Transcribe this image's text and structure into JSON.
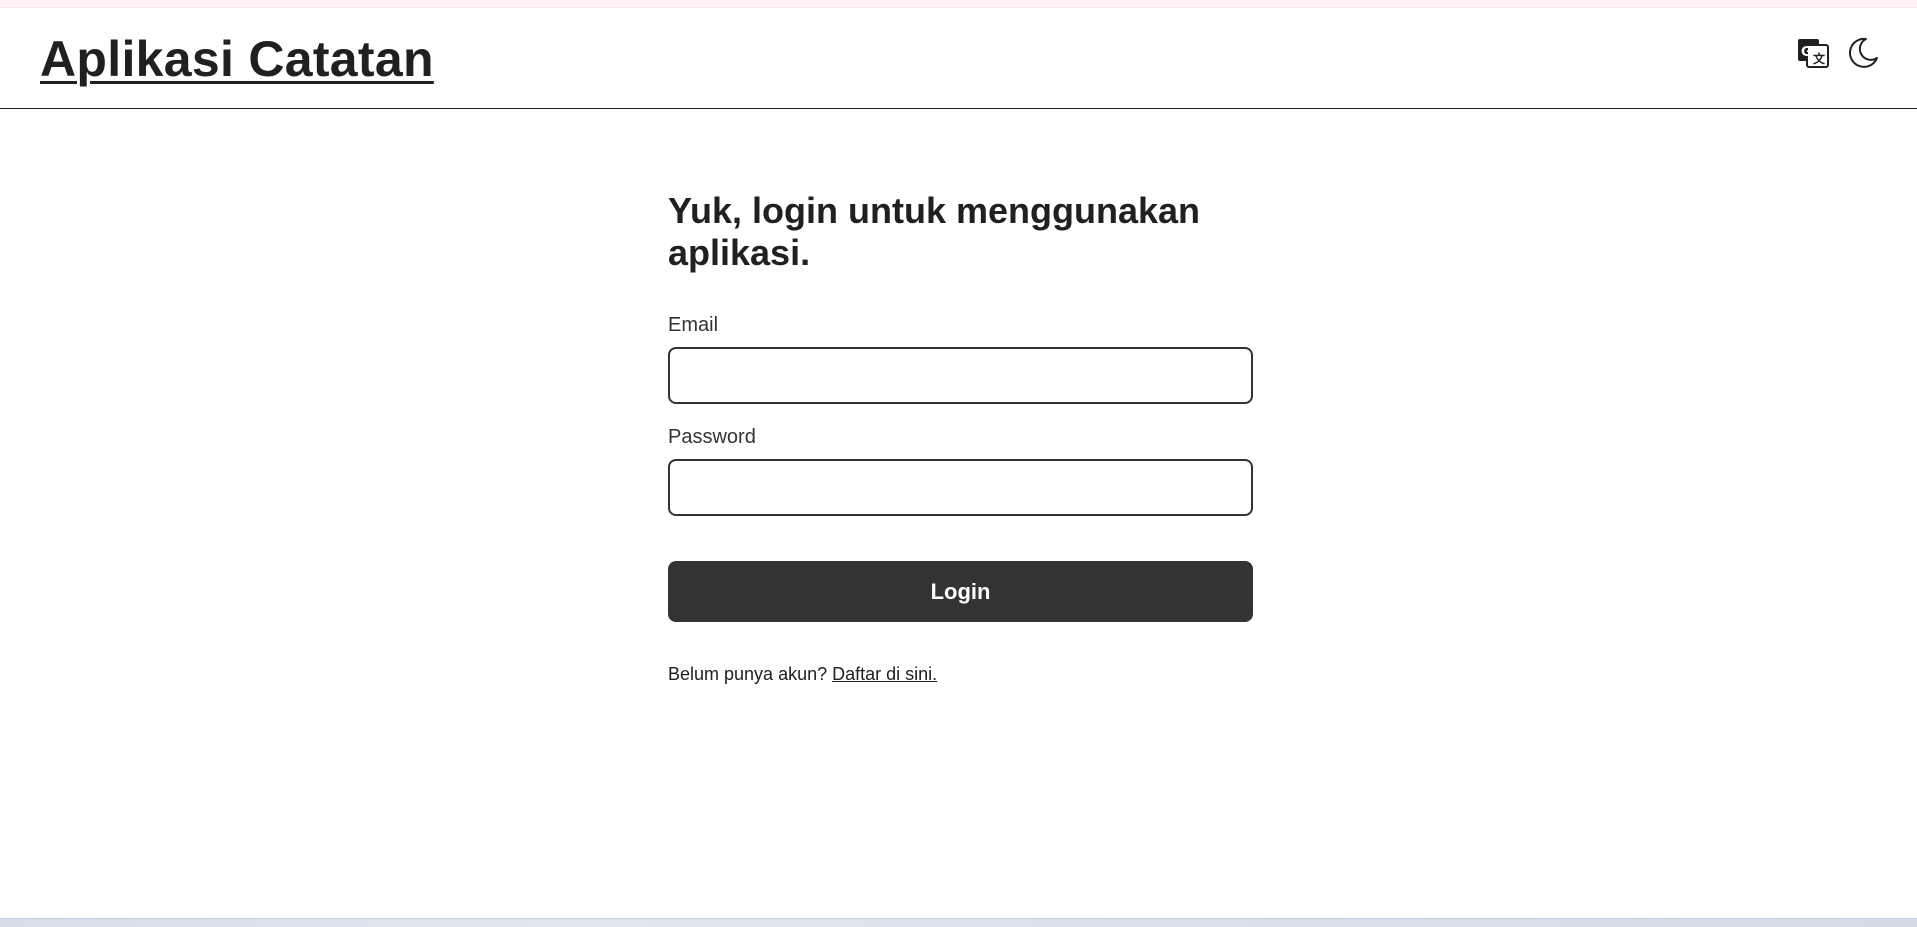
{
  "header": {
    "title": "Aplikasi Catatan",
    "icons": [
      "translate-icon",
      "moon-icon"
    ]
  },
  "login": {
    "heading": "Yuk, login untuk menggunakan aplikasi.",
    "email_label": "Email",
    "email_value": "",
    "password_label": "Password",
    "password_value": "",
    "submit_label": "Login",
    "register_prompt": "Belum punya akun?",
    "register_link": "Daftar di sini."
  },
  "colors": {
    "text": "#202020",
    "button_bg": "#333333",
    "button_text": "#ffffff",
    "background": "#ffffff"
  }
}
